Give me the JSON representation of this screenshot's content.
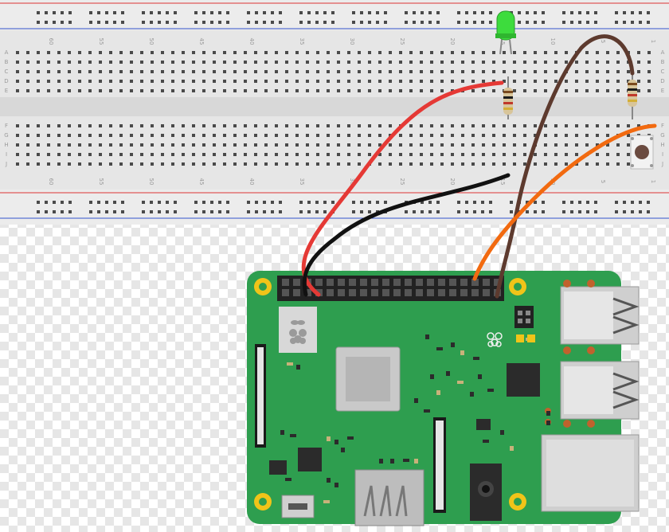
{
  "breadboard": {
    "column_numbers_top": [
      "60",
      "55",
      "50",
      "45",
      "40",
      "35",
      "30",
      "25",
      "20",
      "15",
      "10",
      "5",
      "1"
    ],
    "column_numbers_bottom": [
      "60",
      "55",
      "50",
      "45",
      "40",
      "35",
      "30",
      "25",
      "20",
      "15",
      "10",
      "5",
      "1"
    ],
    "row_letters_top": [
      "A",
      "B",
      "C",
      "D",
      "E"
    ],
    "row_letters_bottom": [
      "F",
      "G",
      "H",
      "I",
      "J"
    ],
    "colors": {
      "body": "#e8e8e8",
      "hole": "#4a4a4a",
      "rail_red": "#d33",
      "rail_blue": "#35c",
      "text": "#9a9a9a"
    }
  },
  "components": {
    "led": {
      "color": "#3ddc3d",
      "name": "green-led"
    },
    "resistor_1": {
      "bands": [
        "#7a4a1e",
        "#1c1c1c",
        "#c0392b",
        "#d4af37"
      ]
    },
    "resistor_2": {
      "bands": [
        "#7a4a1e",
        "#1c1c1c",
        "#c0392b",
        "#d4af37"
      ]
    },
    "button": {
      "cap": "#6b4b40"
    }
  },
  "wires": [
    {
      "name": "red-wire",
      "color": "#e53935"
    },
    {
      "name": "black-wire",
      "color": "#111111"
    },
    {
      "name": "brown-wire",
      "color": "#5d3a2e"
    },
    {
      "name": "orange-wire",
      "color": "#f26a10"
    }
  ],
  "board": {
    "pcb_color": "#2e9e4f",
    "mount_hole": "#f0c419"
  }
}
